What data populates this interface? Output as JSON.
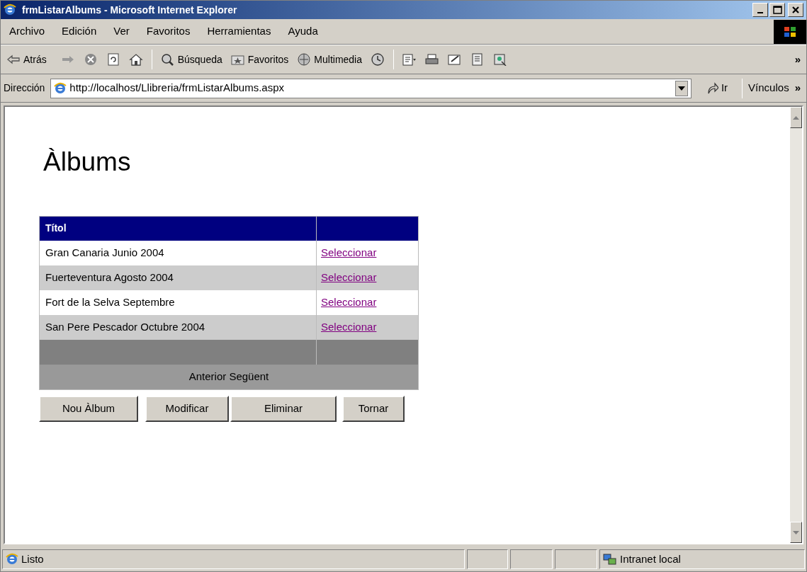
{
  "window": {
    "title": "frmListarAlbums - Microsoft Internet Explorer"
  },
  "menu": [
    "Archivo",
    "Edición",
    "Ver",
    "Favoritos",
    "Herramientas",
    "Ayuda"
  ],
  "toolbar": [
    {
      "kind": "back",
      "label": "Atrás"
    },
    {
      "kind": "forward"
    },
    {
      "kind": "stop"
    },
    {
      "kind": "refresh"
    },
    {
      "kind": "home"
    },
    {
      "kind": "search",
      "label": "Búsqueda"
    },
    {
      "kind": "favorites",
      "label": "Favoritos"
    },
    {
      "kind": "media",
      "label": "Multimedia"
    },
    {
      "kind": "history"
    },
    {
      "kind": "mail"
    },
    {
      "kind": "print"
    },
    {
      "kind": "edit"
    },
    {
      "kind": "discuss"
    },
    {
      "kind": "messenger"
    },
    {
      "kind": "more",
      "label": "»"
    }
  ],
  "address_bar": {
    "label": "Dirección",
    "value": "http://localhost/Llibreria/frmListarAlbums.aspx",
    "go": "Ir",
    "links": "Vínculos",
    "more": "»"
  },
  "page": {
    "heading": "Àlbums",
    "table": {
      "columns": [
        "Títol"
      ],
      "rows": [
        {
          "title": "Gran Canaria Junio 2004",
          "action": "Seleccionar"
        },
        {
          "title": "Fuerteventura Agosto 2004",
          "action": "Seleccionar"
        },
        {
          "title": "Fort de la Selva Septembre",
          "action": "Seleccionar"
        },
        {
          "title": "San Pere Pescador Octubre 2004",
          "action": "Seleccionar"
        }
      ],
      "pager": "Anterior Següent"
    },
    "buttons": [
      "Nou Àlbum",
      "Modificar",
      "Eliminar",
      "Tornar"
    ]
  },
  "status_bar": {
    "text": "Listo",
    "zone": "Intranet local"
  }
}
